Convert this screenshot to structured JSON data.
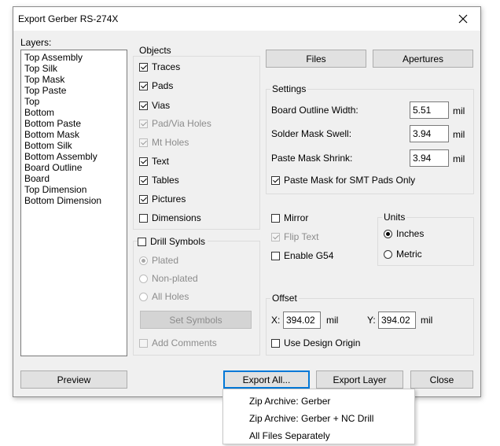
{
  "window": {
    "title": "Export Gerber RS-274X"
  },
  "layers": {
    "label": "Layers:",
    "items": [
      "Top Assembly",
      "Top Silk",
      "Top Mask",
      "Top Paste",
      "Top",
      "Bottom",
      "Bottom Paste",
      "Bottom Mask",
      "Bottom Silk",
      "Bottom Assembly",
      "Board Outline",
      "Board",
      "Top Dimension",
      "Bottom Dimension"
    ]
  },
  "objects": {
    "label": "Objects",
    "items": [
      {
        "label": "Traces",
        "checked": true,
        "disabled": false
      },
      {
        "label": "Pads",
        "checked": true,
        "disabled": false
      },
      {
        "label": "Vias",
        "checked": true,
        "disabled": false
      },
      {
        "label": "Pad/Via Holes",
        "checked": true,
        "disabled": true
      },
      {
        "label": "Mt Holes",
        "checked": true,
        "disabled": true
      },
      {
        "label": "Text",
        "checked": true,
        "disabled": false
      },
      {
        "label": "Tables",
        "checked": true,
        "disabled": false
      },
      {
        "label": "Pictures",
        "checked": true,
        "disabled": false
      },
      {
        "label": "Dimensions",
        "checked": false,
        "disabled": false
      }
    ]
  },
  "drill": {
    "label": "Drill Symbols",
    "options": [
      {
        "label": "Plated",
        "selected": true
      },
      {
        "label": "Non-plated",
        "selected": false
      },
      {
        "label": "All Holes",
        "selected": false
      }
    ],
    "set_symbols_label": "Set Symbols",
    "add_comments_label": "Add Comments"
  },
  "top_buttons": {
    "files": "Files",
    "apertures": "Apertures"
  },
  "settings": {
    "label": "Settings",
    "board_outline_width": {
      "label": "Board Outline Width:",
      "value": "5.51",
      "unit": "mil"
    },
    "solder_mask_swell": {
      "label": "Solder Mask Swell:",
      "value": "3.94",
      "unit": "mil"
    },
    "paste_mask_shrink": {
      "label": "Paste Mask Shrink:",
      "value": "3.94",
      "unit": "mil"
    },
    "paste_smt_only": {
      "label": "Paste Mask for SMT Pads Only",
      "checked": true
    }
  },
  "options": {
    "mirror": {
      "label": "Mirror",
      "checked": false
    },
    "flip_text": {
      "label": "Flip Text",
      "checked": true,
      "disabled": true
    },
    "enable_g54": {
      "label": "Enable G54",
      "checked": false
    }
  },
  "units": {
    "label": "Units",
    "inches": {
      "label": "Inches",
      "selected": true
    },
    "metric": {
      "label": "Metric",
      "selected": false
    }
  },
  "offset": {
    "label": "Offset",
    "x_label": "X:",
    "x_value": "394.02",
    "x_unit": "mil",
    "y_label": "Y:",
    "y_value": "394.02",
    "y_unit": "mil",
    "use_design_origin": {
      "label": "Use Design Origin",
      "checked": false
    }
  },
  "bottom_buttons": {
    "preview": "Preview",
    "export_all": "Export All...",
    "export_layer": "Export Layer",
    "close": "Close"
  },
  "export_menu": {
    "items": [
      "Zip Archive: Gerber",
      "Zip Archive: Gerber + NC Drill",
      "All Files Separately"
    ]
  }
}
